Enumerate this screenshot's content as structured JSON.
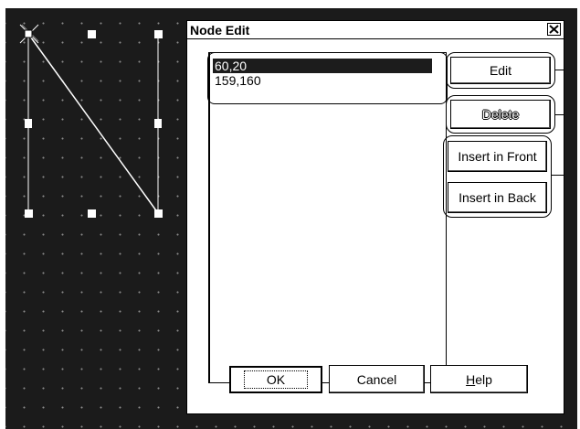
{
  "dialog": {
    "title": "Node Edit",
    "close_glyph": "✕"
  },
  "list": {
    "items": [
      "60,20",
      "159,160"
    ],
    "selected_index": 0
  },
  "buttons": {
    "edit": "Edit",
    "delete": "Delete",
    "insert_front": "Insert in Front",
    "insert_back": "Insert in Back",
    "ok": "OK",
    "cancel": "Cancel",
    "help": "Help"
  },
  "colors": {
    "canvas_bg": "#1b1b1b",
    "grid_dot": "#8a8a8a",
    "selection_bg": "#1c1c1c",
    "handle": "#ffffff"
  },
  "icons": {
    "close": "close-icon",
    "node_marker": "node-cross-icon"
  }
}
